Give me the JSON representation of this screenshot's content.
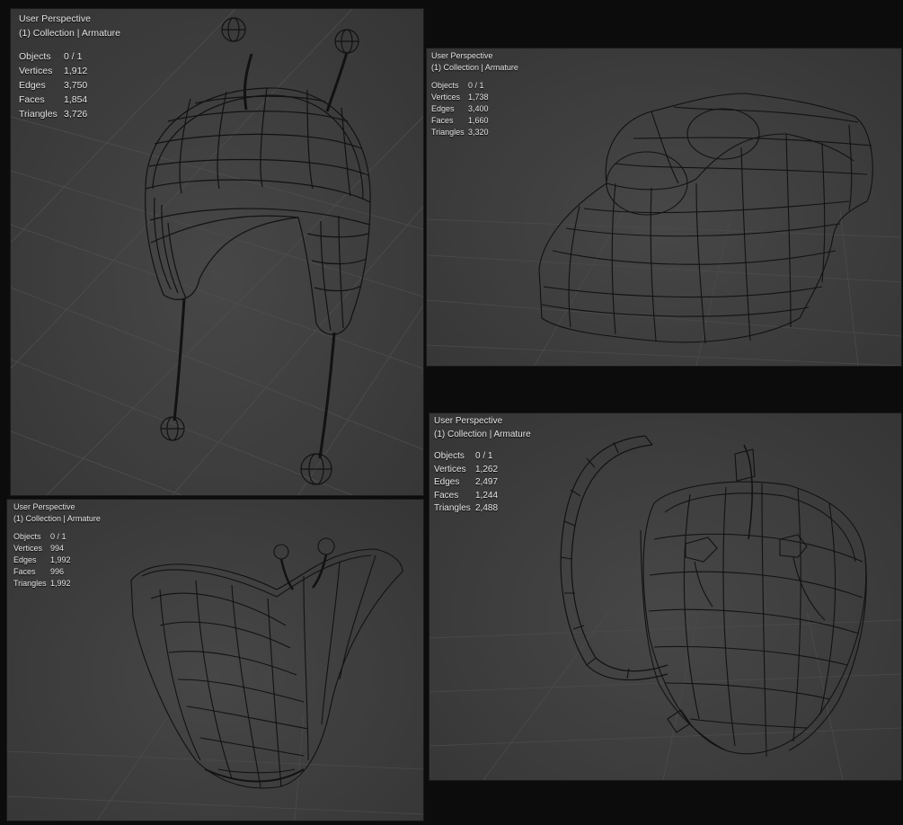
{
  "viewports": [
    {
      "perspective": "User Perspective",
      "collection": "(1) Collection | Armature",
      "stats": {
        "objects": "0 / 1",
        "vertices": "1,912",
        "edges": "3,750",
        "faces": "1,854",
        "triangles": "3,726"
      }
    },
    {
      "perspective": "User Perspective",
      "collection": "(1) Collection | Armature",
      "stats": {
        "objects": "0 / 1",
        "vertices": "1,738",
        "edges": "3,400",
        "faces": "1,660",
        "triangles": "3,320"
      }
    },
    {
      "perspective": "User Perspective",
      "collection": "(1) Collection | Armature",
      "stats": {
        "objects": "0 / 1",
        "vertices": "994",
        "edges": "1,992",
        "faces": "996",
        "triangles": "1,992"
      }
    },
    {
      "perspective": "User Perspective",
      "collection": "(1) Collection | Armature",
      "stats": {
        "objects": "0 / 1",
        "vertices": "1,262",
        "edges": "2,497",
        "faces": "1,244",
        "triangles": "2,488"
      }
    }
  ],
  "labels": {
    "objects": "Objects",
    "vertices": "Vertices",
    "edges": "Edges",
    "faces": "Faces",
    "triangles": "Triangles"
  },
  "colors": {
    "background": "#0c0c0c",
    "viewport": "#3d3d3d",
    "wire": "#121212",
    "grid": "#4d4d4d",
    "text": "#e6e6e6"
  },
  "models": [
    "hat-with-antennae",
    "torso",
    "underwear-with-antennae",
    "backpack"
  ]
}
